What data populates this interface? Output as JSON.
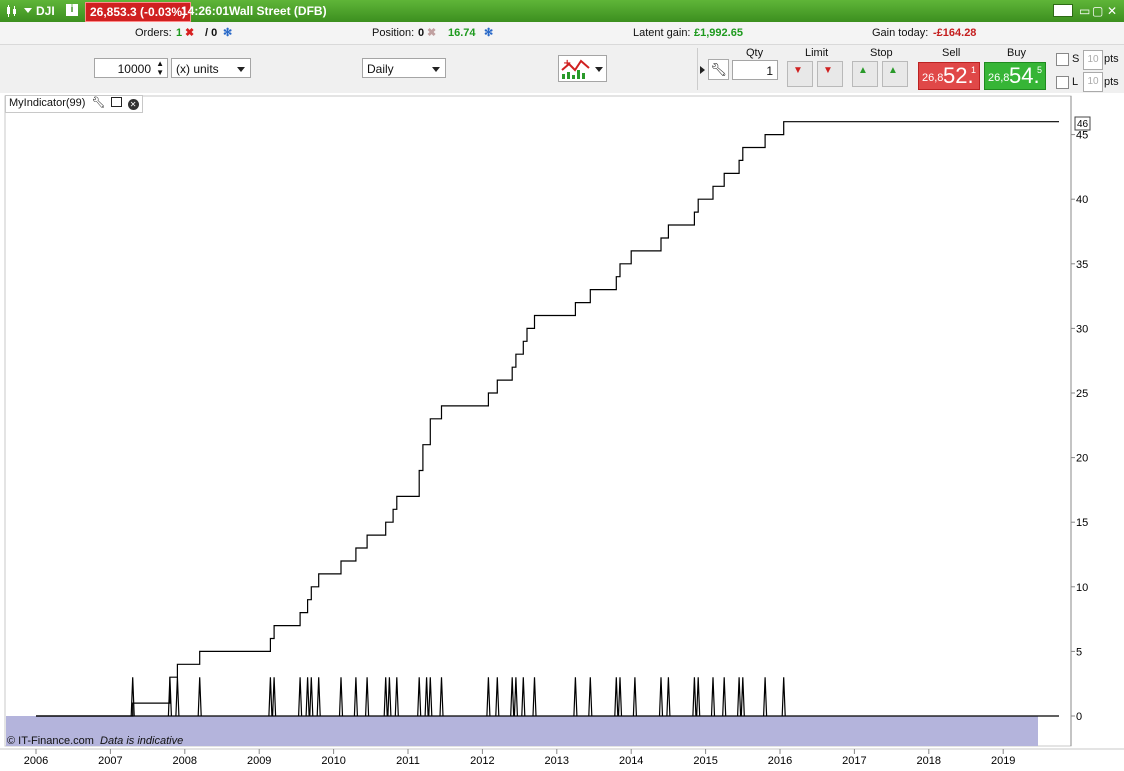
{
  "titlebar": {
    "symbol": "DJI",
    "info_icon": "info-icon",
    "price_change": "26,853.3 (-0.03%)",
    "time": "14:26:01",
    "instrument": "Wall Street (DFB)"
  },
  "infobar": {
    "orders_label": "Orders:",
    "orders_count": "1",
    "orders_count2": "/ 0",
    "position_label": "Position:",
    "position_value": "0",
    "position_pl": "16.74",
    "latent_label": "Latent gain:",
    "latent_value": "£1,992.65",
    "gain_label": "Gain today:",
    "gain_value": "-£164.28"
  },
  "toolbar": {
    "quantity": "10000",
    "units": "(x) units",
    "period": "Daily",
    "qty_label": "Qty",
    "limit_label": "Limit",
    "stop_label": "Stop",
    "sell_label": "Sell",
    "buy_label": "Buy",
    "qty_value": "1",
    "sell_prefix": "26,8",
    "sell_big": "52.",
    "sell_sup": "1",
    "buy_prefix": "26,8",
    "buy_big": "54.",
    "buy_sup": "5",
    "s_label": "S",
    "l_label": "L",
    "pts_value_s": "10",
    "pts_value_l": "10",
    "pts_label_s": "pts",
    "pts_label_l": "pts"
  },
  "indicator": {
    "name": "MyIndicator(99)",
    "footer": "© IT-Finance.com",
    "footer_note": "Data is indicative"
  },
  "colors": {
    "bg_band": "#b4b4dc",
    "line": "#000000"
  },
  "chart_data": {
    "type": "line",
    "title": "",
    "xlabel": "",
    "ylabel": "",
    "x_ticks": [
      "2006",
      "2007",
      "2008",
      "2009",
      "2010",
      "2011",
      "2012",
      "2013",
      "2014",
      "2015",
      "2016",
      "2017",
      "2018",
      "2019"
    ],
    "y_ticks": [
      0,
      5,
      10,
      15,
      20,
      25,
      30,
      35,
      40,
      45
    ],
    "ylim": [
      0,
      46
    ],
    "last_value": "46",
    "series": [
      {
        "points": [
          [
            2006.0,
            0
          ],
          [
            2007.3,
            0
          ],
          [
            2007.3,
            1
          ],
          [
            2007.8,
            1
          ],
          [
            2007.8,
            3
          ],
          [
            2007.9,
            3
          ],
          [
            2007.9,
            4
          ],
          [
            2008.2,
            4
          ],
          [
            2008.2,
            5
          ],
          [
            2009.15,
            5
          ],
          [
            2009.15,
            6
          ],
          [
            2009.2,
            6
          ],
          [
            2009.2,
            7
          ],
          [
            2009.55,
            7
          ],
          [
            2009.55,
            8
          ],
          [
            2009.65,
            8
          ],
          [
            2009.65,
            9
          ],
          [
            2009.7,
            9
          ],
          [
            2009.7,
            10
          ],
          [
            2009.8,
            10
          ],
          [
            2009.8,
            11
          ],
          [
            2010.1,
            11
          ],
          [
            2010.1,
            12
          ],
          [
            2010.3,
            12
          ],
          [
            2010.3,
            13
          ],
          [
            2010.45,
            13
          ],
          [
            2010.45,
            14
          ],
          [
            2010.7,
            14
          ],
          [
            2010.7,
            15
          ],
          [
            2010.8,
            15
          ],
          [
            2010.8,
            16
          ],
          [
            2010.85,
            16
          ],
          [
            2010.85,
            17
          ],
          [
            2011.15,
            17
          ],
          [
            2011.15,
            19
          ],
          [
            2011.2,
            19
          ],
          [
            2011.2,
            21
          ],
          [
            2011.3,
            21
          ],
          [
            2011.3,
            23
          ],
          [
            2011.45,
            23
          ],
          [
            2011.45,
            24
          ],
          [
            2012.08,
            24
          ],
          [
            2012.08,
            25
          ],
          [
            2012.2,
            25
          ],
          [
            2012.2,
            26
          ],
          [
            2012.4,
            26
          ],
          [
            2012.4,
            27
          ],
          [
            2012.45,
            27
          ],
          [
            2012.45,
            28
          ],
          [
            2012.55,
            28
          ],
          [
            2012.55,
            29
          ],
          [
            2012.6,
            29
          ],
          [
            2012.6,
            30
          ],
          [
            2012.7,
            30
          ],
          [
            2012.7,
            31
          ],
          [
            2013.25,
            31
          ],
          [
            2013.25,
            32
          ],
          [
            2013.45,
            32
          ],
          [
            2013.45,
            33
          ],
          [
            2013.8,
            33
          ],
          [
            2013.8,
            34
          ],
          [
            2013.85,
            34
          ],
          [
            2013.85,
            35
          ],
          [
            2014.0,
            35
          ],
          [
            2014.0,
            36
          ],
          [
            2014.4,
            36
          ],
          [
            2014.4,
            37
          ],
          [
            2014.5,
            37
          ],
          [
            2014.5,
            38
          ],
          [
            2014.85,
            38
          ],
          [
            2014.85,
            39
          ],
          [
            2014.9,
            39
          ],
          [
            2014.9,
            40
          ],
          [
            2015.1,
            40
          ],
          [
            2015.1,
            41
          ],
          [
            2015.25,
            41
          ],
          [
            2015.25,
            42
          ],
          [
            2015.45,
            42
          ],
          [
            2015.45,
            43
          ],
          [
            2015.5,
            43
          ],
          [
            2015.5,
            44
          ],
          [
            2015.8,
            44
          ],
          [
            2015.8,
            45
          ],
          [
            2016.05,
            45
          ],
          [
            2016.05,
            46
          ],
          [
            2019.75,
            46
          ]
        ]
      },
      {
        "spikes": [
          2007.3,
          2007.8,
          2007.9,
          2008.2,
          2009.15,
          2009.2,
          2009.55,
          2009.65,
          2009.7,
          2009.8,
          2010.1,
          2010.3,
          2010.45,
          2010.7,
          2010.75,
          2010.85,
          2011.15,
          2011.25,
          2011.3,
          2011.45,
          2012.08,
          2012.2,
          2012.4,
          2012.45,
          2012.55,
          2012.7,
          2013.25,
          2013.45,
          2013.8,
          2013.85,
          2014.05,
          2014.4,
          2014.5,
          2014.85,
          2014.9,
          2015.1,
          2015.25,
          2015.45,
          2015.5,
          2015.8,
          2016.05
        ],
        "spike_height": 3
      }
    ]
  }
}
